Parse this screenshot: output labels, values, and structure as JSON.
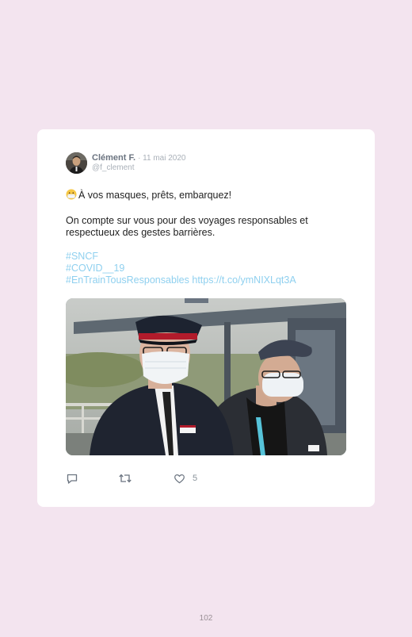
{
  "tweet": {
    "author_name": "Clément F.",
    "date": "· 11 mai 2020",
    "handle": "@f_clement",
    "line1": "À vos masques, prêts, embarquez!",
    "line2": "On compte sur vous pour des voyages responsables et respectueux des gestes barrières.",
    "hashtag1": "#SNCF",
    "hashtag2": "#COVID__19",
    "hashtag3": "#EnTrainTousResponsables",
    "url": "https://t.co/ymNIXLqt3A",
    "like_count": "5"
  },
  "icons": {
    "emoji": "face-with-medical-mask-icon",
    "reply": "reply-icon",
    "retweet": "retweet-icon",
    "like": "heart-icon"
  },
  "colors": {
    "background": "#f3e4ef",
    "card": "#ffffff",
    "link": "#8fd0ef",
    "text": "#1f1f1f",
    "meta": "#a9b0b8"
  },
  "page": {
    "number": "102"
  }
}
